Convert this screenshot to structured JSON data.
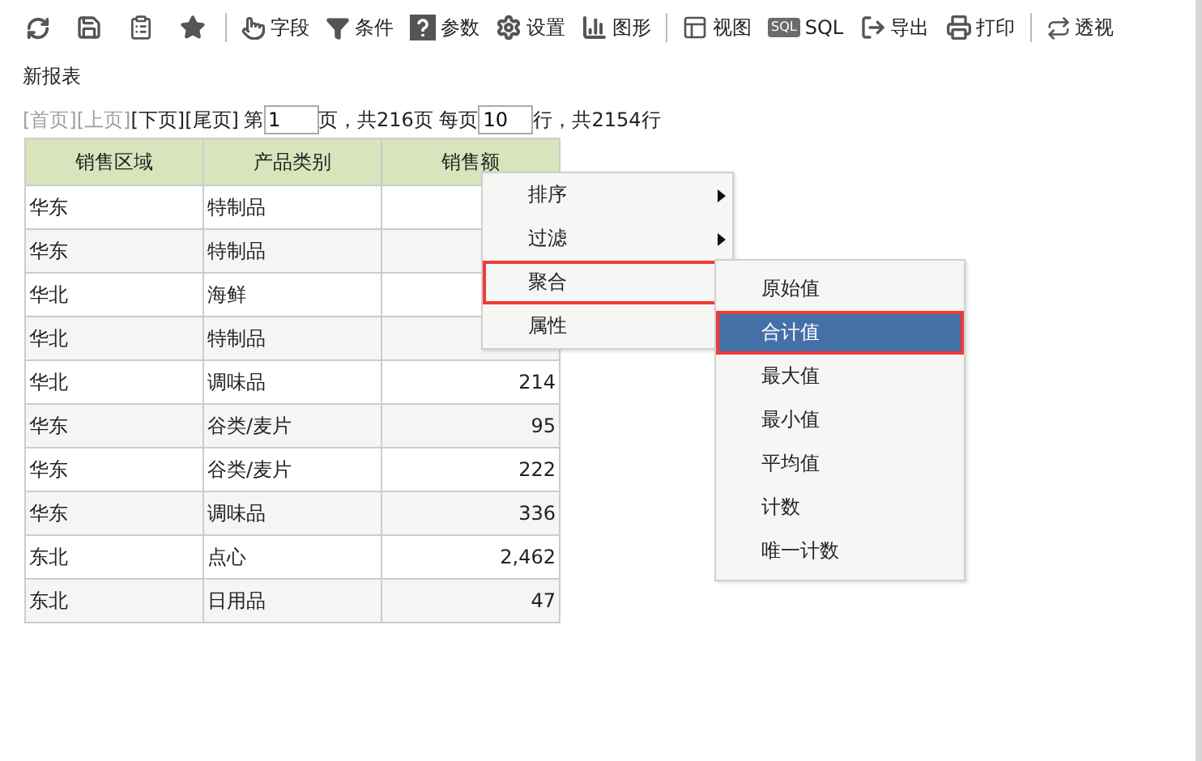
{
  "toolbar": [
    {
      "buttons": [
        {
          "kind": "icon"
        },
        {
          "kind": "icon"
        },
        {
          "kind": "icon"
        },
        {
          "kind": "icon"
        }
      ]
    },
    {
      "buttons": [
        {
          "label": "字段"
        },
        {
          "label": "条件"
        },
        {
          "label": "参数"
        },
        {
          "label": "设置"
        },
        {
          "label": "图形"
        }
      ]
    },
    {
      "buttons": [
        {
          "label": "视图"
        },
        {
          "label": "SQL",
          "icon_text": "SQL"
        },
        {
          "label": "导出"
        },
        {
          "label": "打印"
        }
      ]
    },
    {
      "buttons": [
        {
          "label": "透视"
        }
      ]
    }
  ],
  "report_title": "新报表",
  "pager": {
    "links": [
      {
        "label": "[首页]",
        "disabled": true
      },
      {
        "label": "[上页]",
        "disabled": true
      },
      {
        "label": "[下页]",
        "disabled": false
      },
      {
        "label": "[尾页]",
        "disabled": false
      }
    ],
    "page_prefix": "第",
    "page_value": "1",
    "page_suffix": "页，共216页 每页",
    "size_value": "10",
    "size_suffix": "行，共2154行"
  },
  "table": {
    "columns": [
      "销售区域",
      "产品类别",
      "销售额"
    ],
    "rows": [
      {
        "region": "华东",
        "category": "特制品"
      },
      {
        "region": "华东",
        "category": "特制品"
      },
      {
        "region": "华北",
        "category": "海鲜"
      },
      {
        "region": "华北",
        "category": "特制品"
      },
      {
        "region": "华北",
        "category": "调味品",
        "amount": "214"
      },
      {
        "region": "华东",
        "category": "谷类/麦片",
        "amount": "95"
      },
      {
        "region": "华东",
        "category": "谷类/麦片",
        "amount": "222"
      },
      {
        "region": "华东",
        "category": "调味品",
        "amount": "336"
      },
      {
        "region": "东北",
        "category": "点心",
        "amount": "2,462"
      },
      {
        "region": "东北",
        "category": "日用品",
        "amount": "47"
      }
    ]
  },
  "context_menu": {
    "items": [
      {
        "label": "排序",
        "has_submenu": true,
        "outlined": false
      },
      {
        "label": "过滤",
        "has_submenu": true,
        "outlined": false
      },
      {
        "label": "聚合",
        "outlined": true
      },
      {
        "label": "属性",
        "outlined": false
      }
    ]
  },
  "submenu": {
    "items": [
      {
        "label": "原始值",
        "selected": false,
        "outlined": false
      },
      {
        "label": "合计值",
        "selected": true,
        "outlined": true
      },
      {
        "label": "最大值",
        "selected": false,
        "outlined": false
      },
      {
        "label": "最小值",
        "selected": false,
        "outlined": false
      },
      {
        "label": "平均值",
        "selected": false,
        "outlined": false
      },
      {
        "label": "计数",
        "selected": false,
        "outlined": false
      },
      {
        "label": "唯一计数",
        "selected": false,
        "outlined": false
      }
    ]
  }
}
